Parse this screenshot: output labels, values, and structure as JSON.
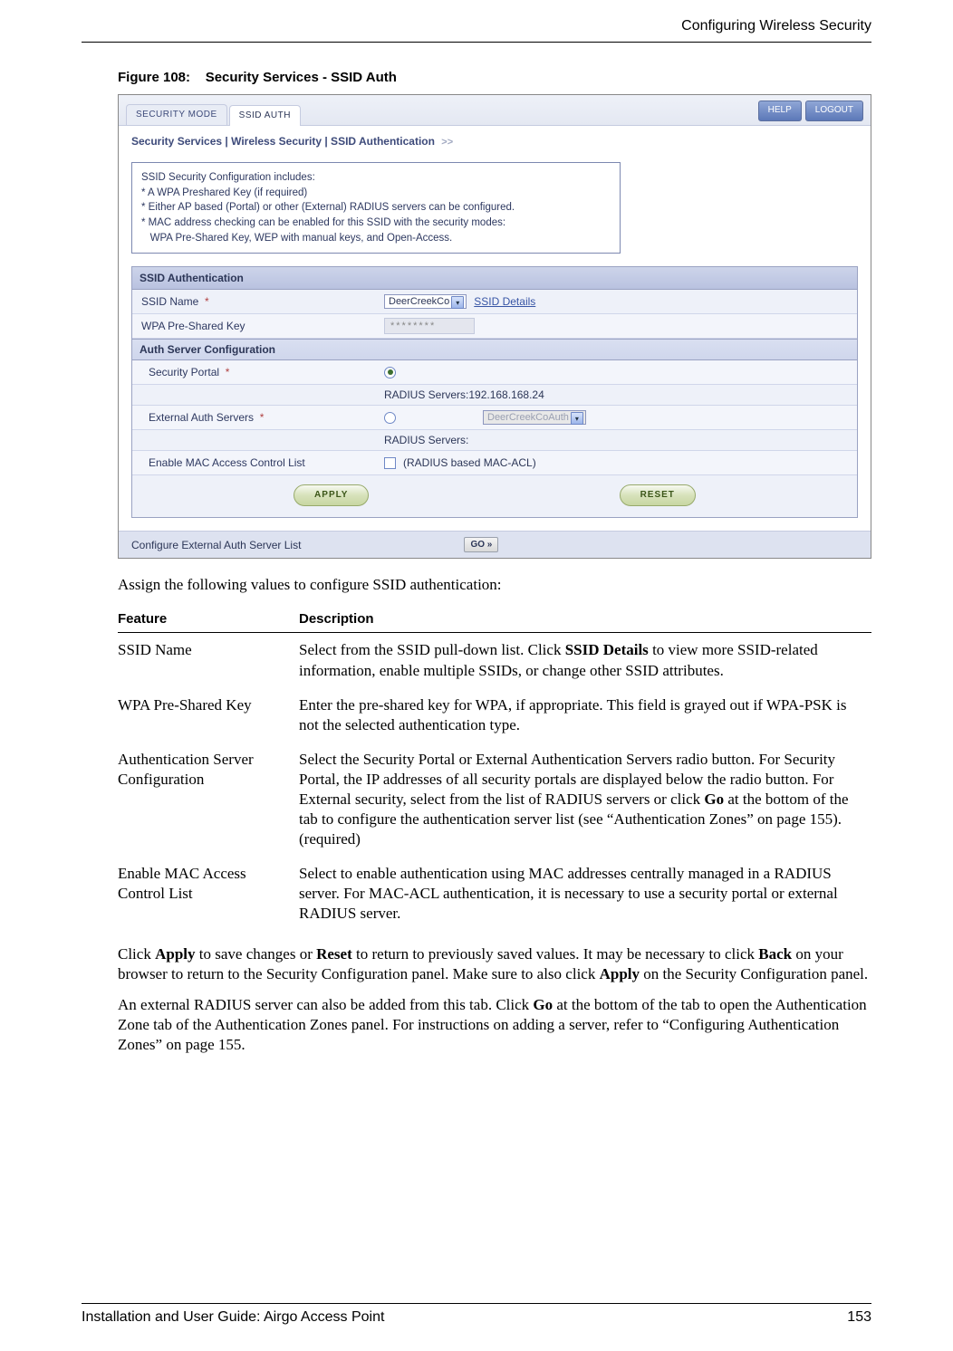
{
  "page": {
    "header_title": "Configuring Wireless Security",
    "footer_left": "Installation and User Guide: Airgo Access Point",
    "footer_right": "153"
  },
  "figure": {
    "caption_prefix": "Figure 108:",
    "caption_title": "Security Services - SSID Auth"
  },
  "screenshot": {
    "tabs": {
      "security_mode": "SECURITY MODE",
      "ssid_auth": "SSID AUTH"
    },
    "topbtns": {
      "help": "HELP",
      "logout": "LOGOUT"
    },
    "breadcrumb": "Security Services | Wireless Security | SSID Authentication",
    "breadcrumb_arrows": ">>",
    "infobox": {
      "l1": "SSID Security Configuration includes:",
      "l2": "* A WPA Preshared Key (if required)",
      "l3": "* Either AP based (Portal) or other (External) RADIUS servers can be configured.",
      "l4": "* MAC address checking can be enabled for this SSID with the security modes:",
      "l5": "   WPA Pre-Shared Key, WEP with manual keys, and Open-Access."
    },
    "panel": {
      "header": "SSID Authentication",
      "ssid_label": "SSID Name",
      "ssid_select": "DeerCreekCo",
      "ssid_details": "SSID Details",
      "wpa_label": "WPA Pre-Shared Key",
      "wpa_value": "********",
      "auth_header": "Auth Server Configuration",
      "portal_label": "Security Portal",
      "radius1": "RADIUS Servers:192.168.168.24",
      "ext_label": "External Auth Servers",
      "ext_select": "DeerCreekCoAuth",
      "radius2": "RADIUS Servers:",
      "mac_label": "Enable MAC Access Control List",
      "mac_check": "(RADIUS based MAC-ACL)",
      "apply": "APPLY",
      "reset": "RESET"
    },
    "bottom": {
      "label": "Configure External Auth Server List",
      "go": "GO »"
    },
    "required": "*"
  },
  "body": {
    "intro": "Assign the following values to configure SSID authentication:",
    "table": {
      "h1": "Feature",
      "h2": "Description",
      "r1f": "SSID Name",
      "r1d_a": "Select from the SSID pull-down list. Click ",
      "r1d_b": "SSID Details",
      "r1d_c": " to view more SSID-related information, enable multiple SSIDs, or change other SSID attributes.",
      "r2f": "WPA Pre-Shared Key",
      "r2d": "Enter the pre-shared key for WPA, if appropriate. This field is grayed out if WPA-PSK is not the selected authentication type.",
      "r3f": "Authentication Server Configuration",
      "r3d_a": "Select the Security Portal or External Authentication Servers radio button. For Security Portal, the IP addresses of all security portals are displayed below the radio button. For External security, select from the list of RADIUS servers or click ",
      "r3d_b": "Go",
      "r3d_c": " at the bottom of the tab to configure the authentication server list (see “Authentication Zones” on page 155). (required)",
      "r4f": "Enable MAC Access Control List",
      "r4d": "Select to enable authentication using MAC addresses centrally managed in a RADIUS server. For MAC-ACL authentication, it is necessary to use a security portal or external RADIUS server."
    },
    "p1_a": "Click ",
    "p1_b": "Apply",
    "p1_c": " to save changes or ",
    "p1_d": "Reset",
    "p1_e": " to return to previously saved values. It may be necessary to click ",
    "p1_f": "Back",
    "p1_g": " on your browser to return to the Security Configuration panel. Make sure to also click ",
    "p1_h": "Apply",
    "p1_i": " on the Security Configuration panel.",
    "p2_a": "An external RADIUS server can also be added from this tab. Click ",
    "p2_b": "Go",
    "p2_c": " at the bottom of the tab to open the Authentication Zone tab of the Authentication Zones panel. For instructions on adding a server, refer to “Configuring Authentication Zones” on page 155."
  }
}
